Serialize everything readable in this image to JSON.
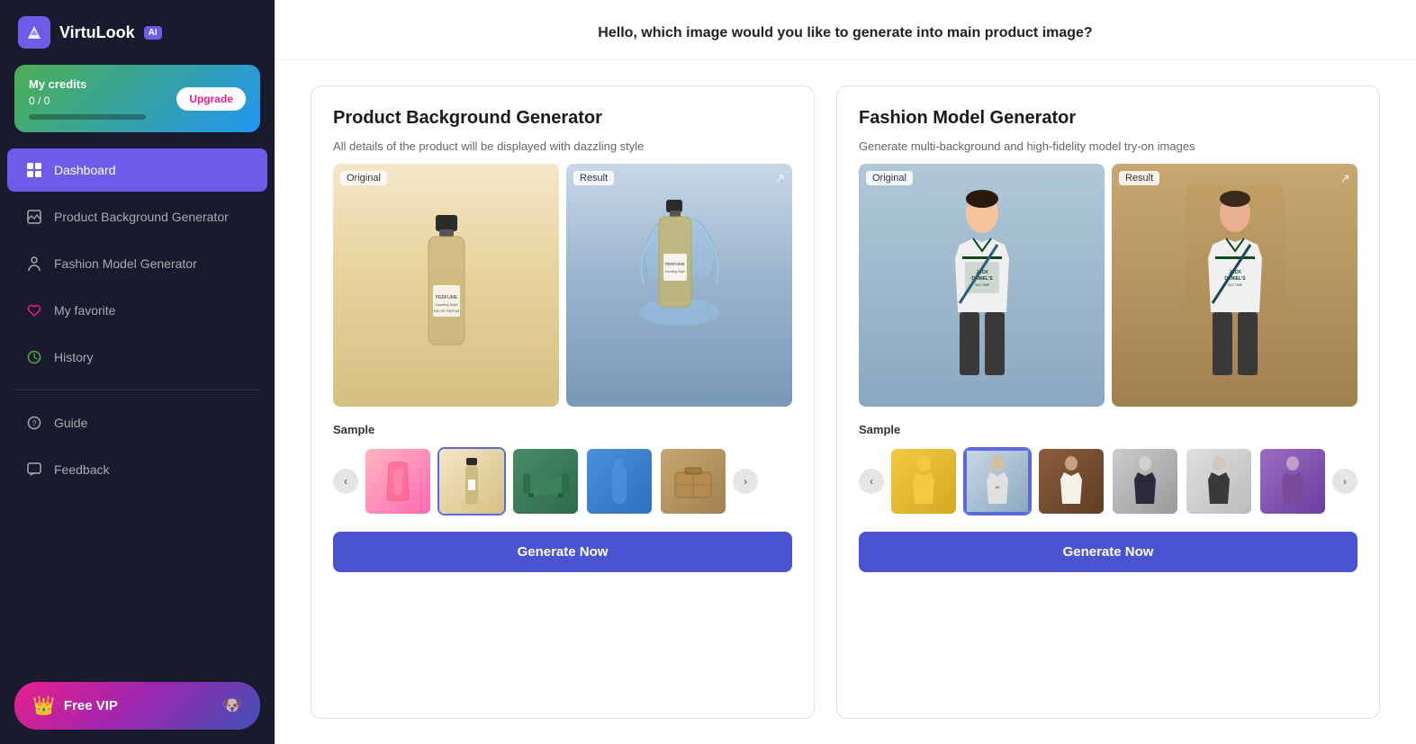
{
  "app": {
    "name": "VirtuLook",
    "ai_badge": "AI"
  },
  "credits": {
    "label": "My credits",
    "upgrade_label": "Upgrade",
    "value": "0 / 0"
  },
  "nav": {
    "dashboard": "Dashboard",
    "product_bg_gen": "Product Background Generator",
    "fashion_model_gen": "Fashion Model Generator",
    "my_favorite": "My favorite",
    "history": "History",
    "guide": "Guide",
    "feedback": "Feedback",
    "free_vip": "Free VIP"
  },
  "main": {
    "greeting": "Hello, which image would you like to generate into main product image?",
    "product_card": {
      "title": "Product Background Generator",
      "desc": "All details of the product will be displayed with dazzling style",
      "original_label": "Original",
      "result_label": "Result",
      "sample_label": "Sample",
      "generate_label": "Generate Now"
    },
    "fashion_card": {
      "title": "Fashion Model Generator",
      "desc": "Generate multi-background and high-fidelity model try-on images",
      "original_label": "Original",
      "result_label": "Result",
      "sample_label": "Sample",
      "generate_label": "Generate Now"
    }
  }
}
